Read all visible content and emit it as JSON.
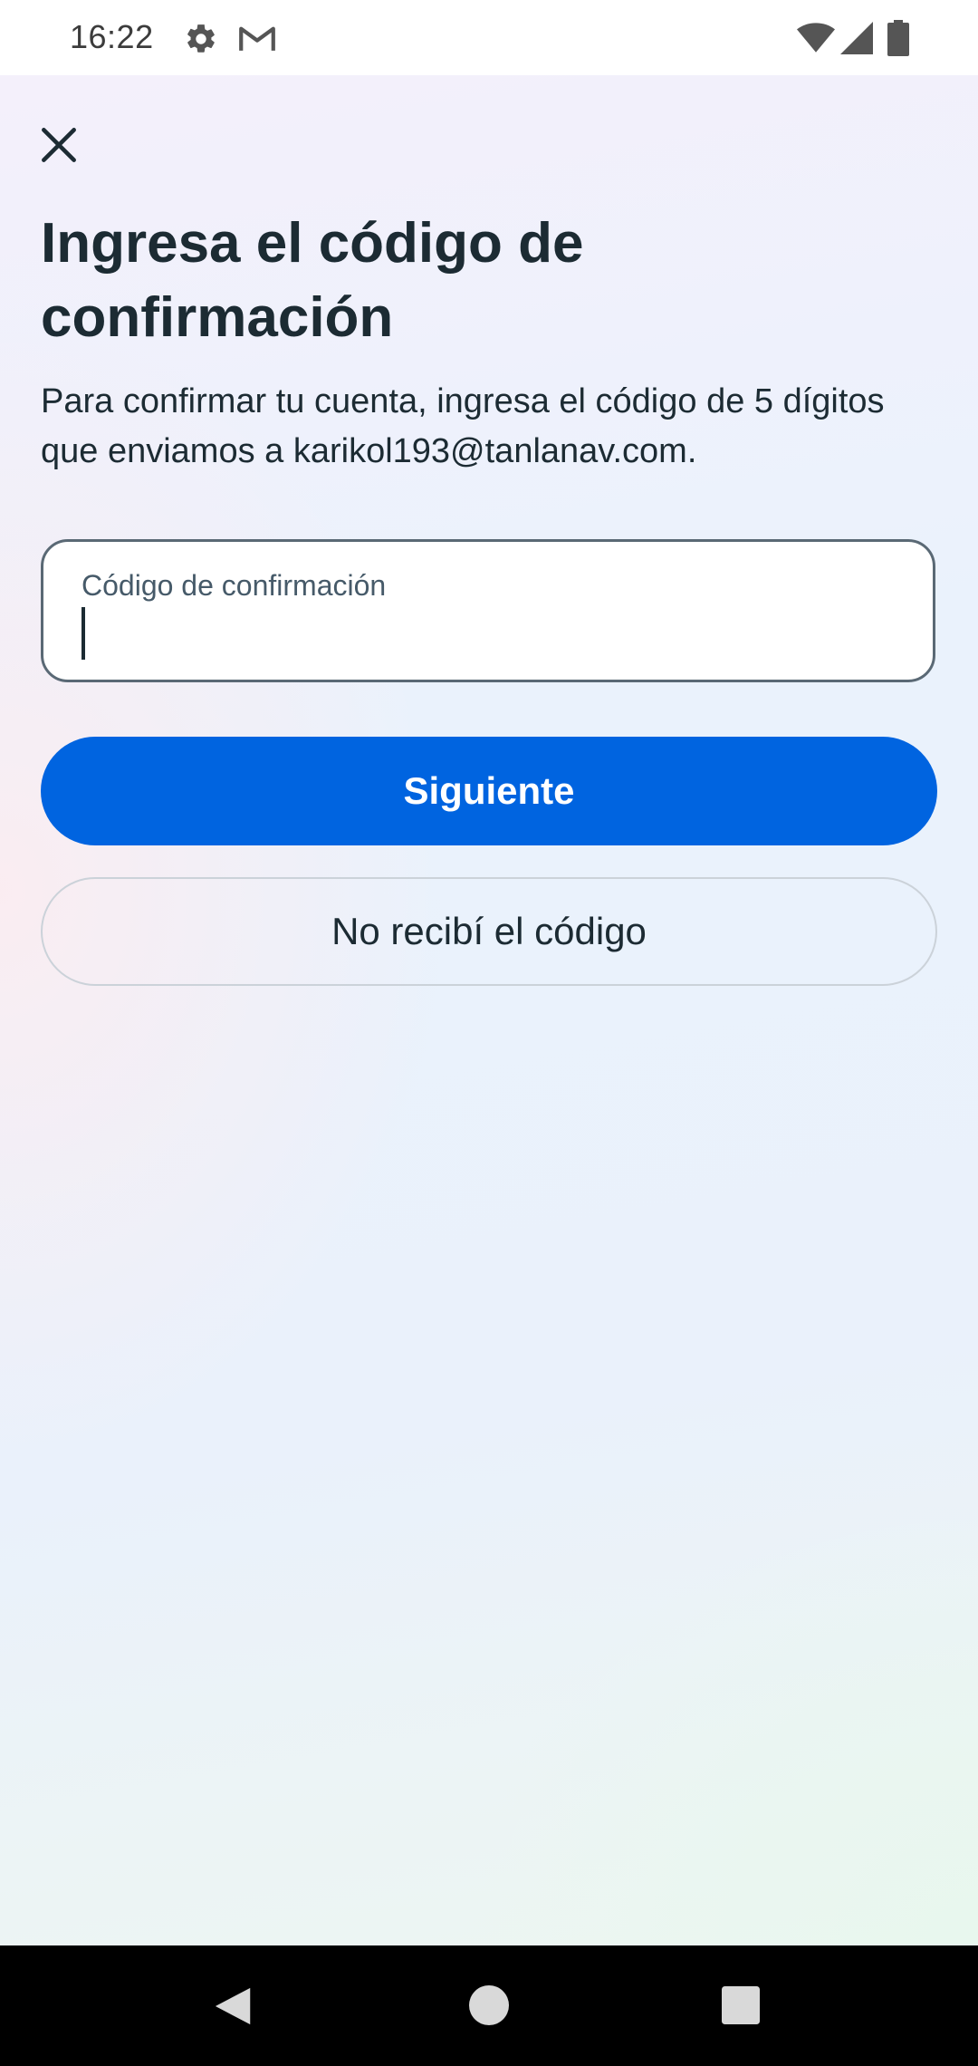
{
  "status_bar": {
    "time": "16:22",
    "icons": [
      "gear-icon",
      "gmail-icon",
      "wifi-icon",
      "signal-icon",
      "battery-icon"
    ]
  },
  "header": {
    "close_icon": "close-icon",
    "title": "Ingresa el código de confirmación",
    "subtitle": "Para confirmar tu cuenta, ingresa el código de 5 dígitos que enviamos a karikol193@tanlanav.com."
  },
  "form": {
    "code_field": {
      "label": "Código de confirmación",
      "value": ""
    },
    "primary_button_label": "Siguiente",
    "secondary_button_label": "No recibí el código"
  },
  "nav_bar": {
    "icons": [
      "back-icon",
      "home-icon",
      "recents-icon"
    ]
  },
  "colors": {
    "primary": "#0064e0",
    "text": "#1c2b33",
    "field_border": "#5a6975",
    "secondary_border": "#cbd2d9"
  }
}
